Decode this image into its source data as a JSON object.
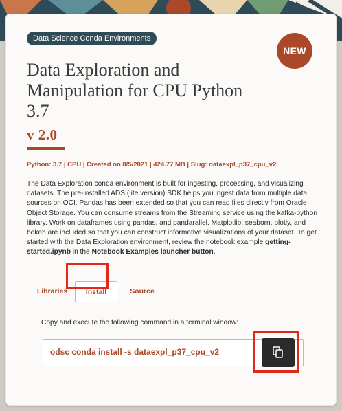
{
  "category_pill": "Data Science Conda Environments",
  "badge": "NEW",
  "title": "Data Exploration and Manipulation for CPU Python 3.7",
  "version": "v 2.0",
  "meta": "Python: 3.7 | CPU | Created on 8/5/2021 | 424.77 MB | Slug: dataexpl_p37_cpu_v2",
  "description": {
    "text": "The Data Exploration conda environment is built for ingesting, processing, and visualizing datasets. The pre-installed ADS (lite version) SDK helps you ingest data from multiple data sources on OCI. Pandas has been extended so that you can read files directly from Oracle Object Storage. You can consume streams from the Streaming service using the kafka-python library. Work on dataframes using pandas, and pandarallel. Matplotlib, seaborn, plotly, and bokeh are included so that you can construct informative visualizations of your dataset. To get started with the Data Exploration environment, review the notebook example ",
    "bold1": "getting-started.ipynb",
    "mid": " in the ",
    "bold2": "Notebook Examples launcher button",
    "end": "."
  },
  "tabs": [
    {
      "label": "Libraries"
    },
    {
      "label": "Install",
      "selected": true
    },
    {
      "label": "Source"
    }
  ],
  "install_panel": {
    "instruction": "Copy and execute the following command in a terminal window:",
    "command": "odsc conda install -s dataexpl_p37_cpu_v2",
    "copy_icon": "copy-icon"
  },
  "colors": {
    "accent": "#a9492a",
    "pill_bg": "#2f4b57",
    "highlight": "#e0291b",
    "button_dark": "#2b2b2b"
  }
}
